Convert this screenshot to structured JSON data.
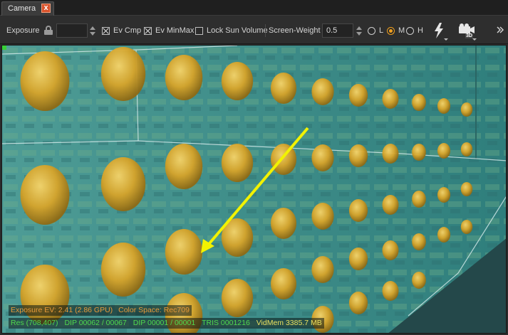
{
  "tab": {
    "title": "Camera",
    "close_glyph": "x"
  },
  "toolbar": {
    "exposure_label": "Exposure",
    "exposure_value": "",
    "ev_cmp_label": "Ev Cmp",
    "ev_cmp_checked": true,
    "ev_minmax_label": "Ev MinMax",
    "ev_minmax_checked": true,
    "lock_sun_label": "Lock Sun Volume",
    "lock_sun_checked": false,
    "screen_weight_label": "Screen-Weight",
    "screen_weight_value": "0.5",
    "quality_options": [
      {
        "label": "L",
        "selected": false
      },
      {
        "label": "M",
        "selected": true
      },
      {
        "label": "H",
        "selected": false
      }
    ],
    "flash_icon": "lightning-icon",
    "camera_icon": "camera-3d-icon",
    "camera_badge": "3D"
  },
  "hud": {
    "exposure_ev": "Exposure EV: 2.41 (2.86 GPU)",
    "color_space": "Color Space: Rec709",
    "res": "Res (708,407)",
    "dip1": "DIP 00062 / 00067",
    "dip2": "DIP 00001 / 00001",
    "tris": "TRIS 0001216",
    "vidmem": "VidMem 3385.7 MB"
  },
  "colors": {
    "accent": "#f0a020",
    "hud_orange": "#e89a3a",
    "hud_green": "#4fd84f",
    "hud_yellow": "#e8e060",
    "tab_close": "#d9532c",
    "arrow": "#f2f200",
    "wall": "#3c8a86",
    "ground": "#24484a"
  }
}
